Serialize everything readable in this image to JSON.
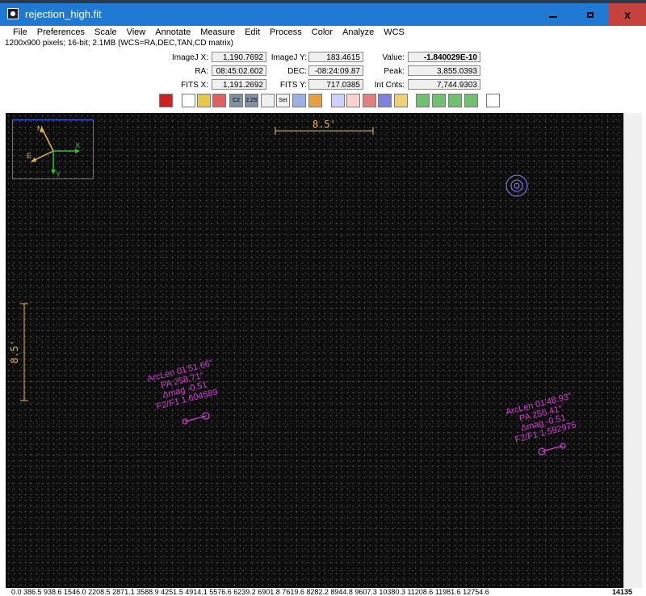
{
  "window": {
    "title": "rejection_high.fit",
    "min_label": "",
    "max_label": "",
    "close_label": "x"
  },
  "menu": [
    "File",
    "Preferences",
    "Scale",
    "View",
    "Annotate",
    "Measure",
    "Edit",
    "Process",
    "Color",
    "Analyze",
    "WCS"
  ],
  "info": "1200x900 pixels; 16-bit; 2.1MB (WCS=RA,DEC,TAN,CD matrix)",
  "readout": {
    "imagej_x_label": "ImageJ X:",
    "imagej_x": "1,190.7692",
    "imagej_y_label": "ImageJ Y:",
    "imagej_y": "183.4615",
    "value_label": "Value:",
    "value": "-1.840029E-10",
    "ra_label": "RA:",
    "ra": "08:45:02.602",
    "dec_label": "DEC:",
    "dec": "-08:24:09.87",
    "peak_label": "Peak:",
    "peak": "3,855.0393",
    "fits_x_label": "FITS X:",
    "fits_x": "1,191.2692",
    "fits_y_label": "FITS Y:",
    "fits_y": "717.0385",
    "intcnts_label": "Int Cnts:",
    "intcnts": "7,744.9303"
  },
  "toolbar": {
    "buttons": [
      {
        "name": "clear-overlay-icon",
        "text": "",
        "bg": "#cc2222"
      },
      {
        "name": "invert-icon",
        "text": "",
        "bg": "#ffffff"
      },
      {
        "name": "aperture-yellow-icon",
        "text": "",
        "bg": "#e8c84a"
      },
      {
        "name": "aperture-red-icon",
        "text": "",
        "bg": "#e06060"
      },
      {
        "name": "centroid-icon",
        "text": "C2",
        "bg": "#8090a0"
      },
      {
        "name": "zoom-2x-icon",
        "text": "2.2S",
        "bg": "#8090a0"
      },
      {
        "name": "target-icon",
        "text": "",
        "bg": "#f0f0f0"
      },
      {
        "name": "set-aperture-icon",
        "text": "Set",
        "bg": "#f0f0f0"
      },
      {
        "name": "measure-pen-icon",
        "text": "",
        "bg": "#9ab0e8"
      },
      {
        "name": "edit-pen-icon",
        "text": "",
        "bg": "#e8a040"
      },
      {
        "name": "photometer-icon",
        "text": "",
        "bg": "#d0d0ff"
      },
      {
        "name": "multi-aperture-icon",
        "text": "",
        "bg": "#ffd0d0"
      },
      {
        "name": "astrometry-icon",
        "text": "",
        "bg": "#e08080"
      },
      {
        "name": "crosshair-icon",
        "text": "",
        "bg": "#8080e0"
      },
      {
        "name": "table-icon",
        "text": "",
        "bg": "#f0d070"
      },
      {
        "name": "zoom-fit-icon",
        "text": "",
        "bg": "#70c070"
      },
      {
        "name": "zoom-in-icon",
        "text": "",
        "bg": "#70c070"
      },
      {
        "name": "zoom-out-icon",
        "text": "",
        "bg": "#70c070"
      },
      {
        "name": "zoom-full-icon",
        "text": "",
        "bg": "#70c070"
      },
      {
        "name": "contrast-icon",
        "text": "",
        "bg": "#ffffff"
      }
    ]
  },
  "overlay": {
    "compass": {
      "n": "N",
      "e": "E",
      "x": "X",
      "y": "Y"
    },
    "scale_h": "8.5'",
    "scale_v": "8.5'",
    "annot1": [
      "ArcLen 01'51.66\"",
      "PA 258.71°",
      "Δmag -0.51",
      "F2/F1 1.604589"
    ],
    "annot2": [
      "ArcLen 01'48.93\"",
      "PA 255.41°",
      "Δmag -0.51",
      "F2/F1 1.592975"
    ],
    "colors": {
      "annotation": "#d63ad6",
      "scale": "#e6b84a",
      "aperture": "#8a8aff"
    }
  },
  "bottom": {
    "ticks": "0.0 386.5 938.6 1546.0 2208.5 2871.1 3588.9 4251.5 4914.1 5576.6 6239.2 6901.8 7619.6 8282.2 8944.8 9607.3 10380.3 11208.6 11981.6 12754.6",
    "max": "14135"
  }
}
